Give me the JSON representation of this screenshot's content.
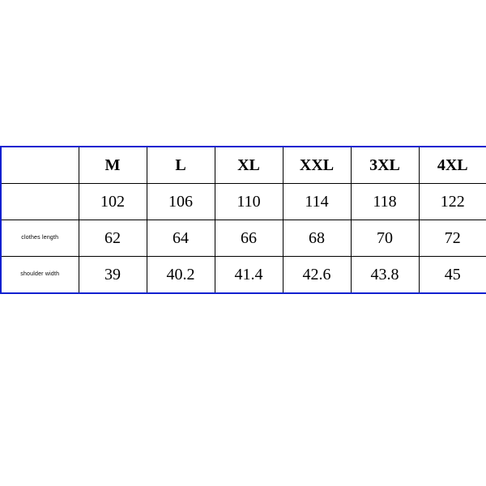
{
  "chart_data": {
    "type": "table",
    "title": "",
    "columns": [
      "M",
      "L",
      "XL",
      "XXL",
      "3XL",
      "4XL"
    ],
    "rows": [
      {
        "label": "",
        "values": [
          102,
          106,
          110,
          114,
          118,
          122
        ]
      },
      {
        "label": "clothes length",
        "values": [
          62,
          64,
          66,
          68,
          70,
          72
        ]
      },
      {
        "label": "shoulder width",
        "values": [
          39,
          40.2,
          41.4,
          42.6,
          43.8,
          45
        ]
      }
    ]
  }
}
